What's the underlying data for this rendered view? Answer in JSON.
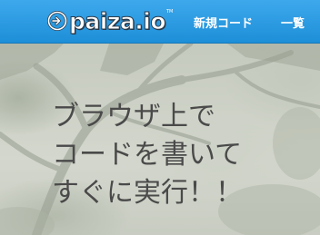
{
  "header": {
    "logo_text": "paiza.io",
    "logo_tm": "TM",
    "nav": {
      "new_code": "新規コード",
      "list": "一覧"
    }
  },
  "hero": {
    "tagline_lines": [
      "ブラウザ上で",
      "コードを書いて",
      "すぐに実行！！"
    ]
  },
  "colors": {
    "header_blue": "#1d8fd8",
    "tagline_text": "#4a4a4a"
  }
}
